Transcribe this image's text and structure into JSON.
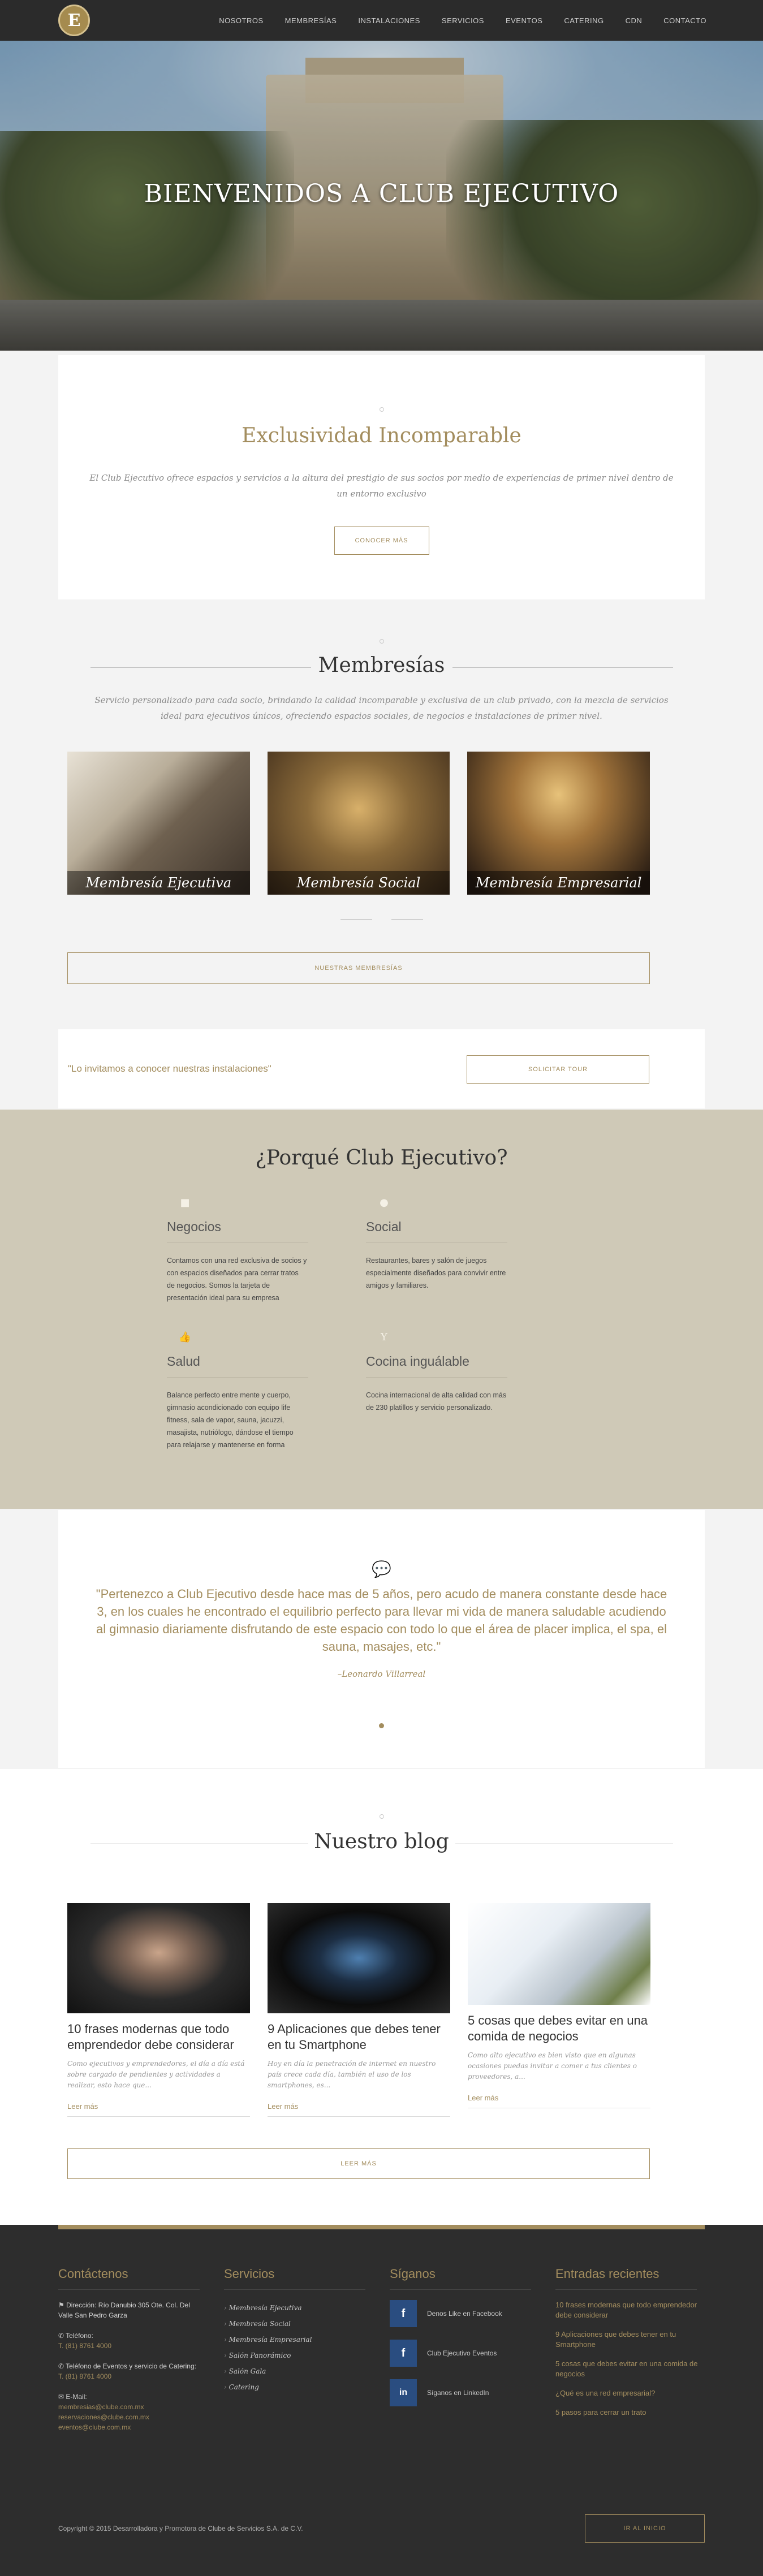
{
  "nav": {
    "logo_letter": "E",
    "items": [
      "NOSOTROS",
      "MEMBRESÍAS",
      "INSTALACIONES",
      "SERVICIOS",
      "EVENTOS",
      "CATERING",
      "CDN",
      "CONTACTO"
    ]
  },
  "hero": {
    "title": "BIENVENIDOS A CLUB EJECUTIVO"
  },
  "exclusividad": {
    "title": "Exclusividad Incomparable",
    "text": "El Club Ejecutivo ofrece espacios y servicios a la altura del prestigio de sus socios por medio de experiencias de primer nivel dentro de un entorno exclusivo",
    "button": "CONOCER MÁS"
  },
  "membresias": {
    "title": "Membresías",
    "text": "Servicio personalizado para cada socio, brindando la calidad incomparable y exclusiva de un club privado, con la mezcla de servicios ideal para ejecutivos únicos, ofreciendo espacios sociales, de negocios e instalaciones de primer nivel.",
    "cards": [
      "Membresía Ejecutiva",
      "Membresía Social",
      "Membresía Empresarial"
    ],
    "button": "NUESTRAS MEMBRESÍAS"
  },
  "invite": {
    "text": "\"Lo invitamos a conocer nuestras instalaciones\"",
    "button": "SOLICITAR TOUR"
  },
  "porque": {
    "title": "¿Porqué Club Ejecutivo?",
    "features": [
      {
        "icon": "briefcase-icon",
        "title": "Negocios",
        "text": "Contamos con una red exclusiva de socios y con espacios diseñados para cerrar tratos de negocios. Somos la tarjeta de presentación ideal para su empresa"
      },
      {
        "icon": "globe-icon",
        "title": "Social",
        "text": "Restaurantes, bares y salón de juegos especialmente diseñados para convivir entre amigos y familiares."
      },
      {
        "icon": "thumbs-up-icon",
        "title": "Salud",
        "text": "Balance perfecto entre mente y cuerpo, gimnasio acondicionado con equipo life fitness, sala de vapor, sauna, jacuzzi, masajista, nutriólogo, dándose el tiempo para relajarse y mantenerse en forma"
      },
      {
        "icon": "cocktail-icon",
        "title": "Cocina inguálable",
        "text": "Cocina internacional de alta calidad con más de 230 platillos y servicio personalizado."
      }
    ]
  },
  "testimonial": {
    "quote": "\"Pertenezco a Club Ejecutivo desde hace mas de 5 años, pero acudo de manera constante desde hace 3, en los cuales he encontrado el equilibrio perfecto para llevar mi vida de manera saludable acudiendo al gimnasio diariamente disfrutando de este espacio con todo lo que el área de placer implica, el spa, el sauna, masajes, etc.\"",
    "author": "–Leonardo Villarreal"
  },
  "blog": {
    "title": "Nuestro blog",
    "posts": [
      {
        "title": "10 frases modernas que todo emprendedor debe considerar",
        "excerpt": "Como ejecutivos y emprendedores, el día a día está sobre cargado de pendientes y actividades a realizar, esto hace que...",
        "more": "Leer más"
      },
      {
        "title": "9 Aplicaciones que debes tener en tu Smartphone",
        "excerpt": "Hoy en día la penetración de internet en nuestro país crece cada día, también el uso de los smartphones, es...",
        "more": "Leer más"
      },
      {
        "title": "5 cosas que debes evitar en una comida de negocios",
        "excerpt": "Como alto ejecutivo es bien visto que en algunas ocasiones puedas invitar a comer a tus clientes o proveedores, a...",
        "more": "Leer más"
      }
    ],
    "button": "LEER MÁS"
  },
  "footer": {
    "contact": {
      "title": "Contáctenos",
      "address_label": "Dirección: Río Danubio 305 Ote. Col. Del Valle San Pedro Garza",
      "phone_label": "Teléfono:",
      "phone": "T. (81) 8761 4000",
      "events_label": "Teléfono de Eventos y servicio de Catering:",
      "events_phone": "T. (81) 8761 4000",
      "email_label": "E-Mail:",
      "emails": [
        "membresias@clube.com.mx",
        "reservaciones@clube.com.mx",
        "eventos@clube.com.mx"
      ]
    },
    "services": {
      "title": "Servicios",
      "items": [
        "Membresía Ejecutiva",
        "Membresía Social",
        "Membresía Empresarial",
        "Salón Panorámico",
        "Salón Gala",
        "Catering"
      ]
    },
    "social": {
      "title": "Síganos",
      "items": [
        {
          "icon": "facebook-icon",
          "glyph": "f",
          "label": "Denos Like en Facebook"
        },
        {
          "icon": "facebook-icon",
          "glyph": "f",
          "label": "Club Ejecutivo Eventos"
        },
        {
          "icon": "linkedin-icon",
          "glyph": "in",
          "label": "Síganos en LinkedIn"
        }
      ]
    },
    "recent": {
      "title": "Entradas recientes",
      "items": [
        "10 frases modernas que todo emprendedor debe considerar",
        "9 Aplicaciones que debes tener en tu Smartphone",
        "5 cosas que debes evitar en una comida de negocios",
        "¿Qué es una red empresarial?",
        "5 pasos para cerrar un trato"
      ]
    },
    "copyright": "Copyright © 2015 Desarrolladora y Promotora de Clube de Servicios S.A. de C.V.",
    "top_button": "IR AL INICIO"
  },
  "colors": {
    "accent": "#a38d5e",
    "dark": "#2b2b2b",
    "beige": "#cfc9b7"
  }
}
